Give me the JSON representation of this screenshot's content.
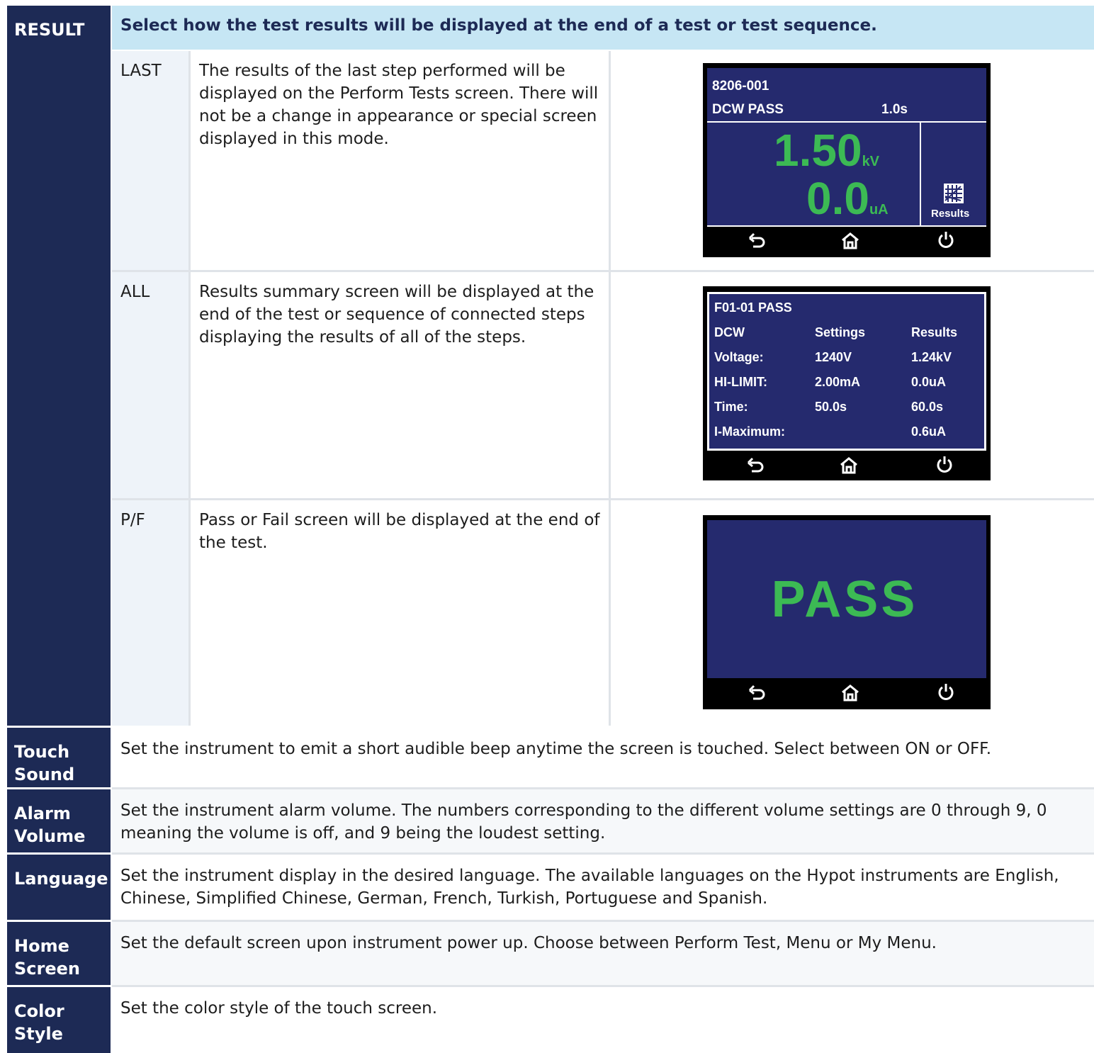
{
  "result": {
    "label": "RESULT",
    "header": "Select how the test results will be displayed at the end of a test or test sequence.",
    "options": [
      {
        "name": "LAST",
        "description": "The results of the last step performed will be displayed on the Perform Tests screen. There will not be a change in appearance or special screen displayed in this mode."
      },
      {
        "name": "ALL",
        "description": "Results summary screen will be displayed at the end of the test or sequence of connected steps displaying the results of all of the steps."
      },
      {
        "name": "P/F",
        "description": "Pass or Fail screen will be displayed at the end of the test."
      }
    ]
  },
  "screen_last": {
    "file": "8206-001",
    "status": "DCW PASS",
    "time": "1.0s",
    "voltage": "1.50",
    "voltage_unit": "kV",
    "current": "0.0",
    "current_unit": "uA",
    "results_label": "Results"
  },
  "screen_all": {
    "title": "F01-01  PASS",
    "col0": "DCW",
    "col1": "Settings",
    "col2": "Results",
    "rows": [
      {
        "label": "Voltage:",
        "setting": "1240V",
        "result": "1.24kV"
      },
      {
        "label": "HI-LIMIT:",
        "setting": "2.00mA",
        "result": "0.0uA"
      },
      {
        "label": "Time:",
        "setting": "50.0s",
        "result": "60.0s"
      },
      {
        "label": "I-Maximum:",
        "setting": "",
        "result": "0.6uA"
      }
    ]
  },
  "screen_pf": {
    "text": "PASS"
  },
  "settings": [
    {
      "label": "Touch Sound",
      "description": "Set the instrument to emit a short audible beep anytime the screen is touched. Select between ON or OFF."
    },
    {
      "label": "Alarm Volume",
      "description": "Set the instrument alarm volume. The numbers corresponding to the different volume settings are 0 through 9, 0 meaning the volume is off, and 9 being the loudest setting."
    },
    {
      "label": "Language",
      "description": "Set the instrument display in the desired language. The available languages on the Hypot instruments are English, Chinese, Simplified Chinese, German, French, Turkish, Portuguese and Spanish."
    },
    {
      "label": "Home Screen",
      "description": "Set the default screen upon instrument power up. Choose between Perform Test, Menu or My Menu."
    },
    {
      "label": "Color Style",
      "description": "Set the color style of the touch screen."
    }
  ],
  "colors": {
    "navy": "#1d2a55",
    "header_blue": "#c6e6f4",
    "screen_blue": "#252a6e",
    "pass_green": "#3cba54"
  },
  "icons": [
    "back-icon",
    "home-icon",
    "power-icon",
    "chart-icon"
  ]
}
